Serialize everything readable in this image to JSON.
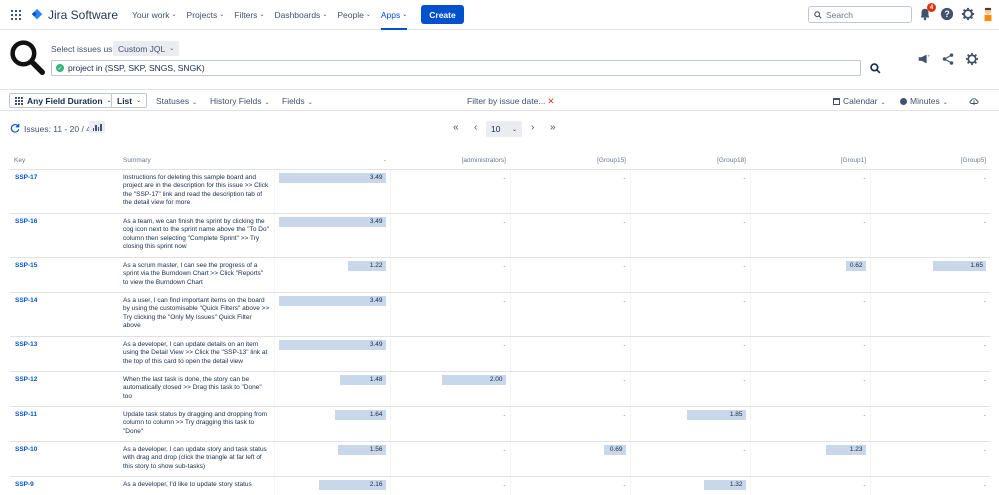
{
  "nav": {
    "logo_text": "Jira Software",
    "items": [
      {
        "label": "Your work",
        "active": false
      },
      {
        "label": "Projects",
        "active": false
      },
      {
        "label": "Filters",
        "active": false
      },
      {
        "label": "Dashboards",
        "active": false
      },
      {
        "label": "People",
        "active": false
      },
      {
        "label": "Apps",
        "active": true
      }
    ],
    "create_label": "Create",
    "search_placeholder": "Search",
    "notification_count": "4",
    "chevron": "⌄"
  },
  "jql": {
    "select_label": "Select issues using",
    "mode": "Custom JQL",
    "query": "project in (SSP, SKP, SNGS, SNGK)"
  },
  "toolbar": {
    "any_field_duration": "Any Field Duration",
    "list": "List",
    "statuses": "Statuses",
    "history_fields": "History Fields",
    "fields": "Fields",
    "filter_by_date": "Filter by issue date...",
    "calendar": "Calendar",
    "minutes": "Minutes"
  },
  "issues": {
    "count": "Issues: 11 - 20 / 47",
    "page_size": "10",
    "first": "«",
    "prev": "‹",
    "next": "›",
    "last": "»"
  },
  "table": {
    "headers": [
      "Key",
      "Summary",
      "-",
      "[administrators]",
      "[Group15]",
      "[Group18]",
      "[Group1]",
      "[Group5]"
    ],
    "max_value": 3.49,
    "rows": [
      {
        "key": "SSP-17",
        "summary": "Instructions for deleting this sample board and project are in the description for this issue >> Click the \"SSP-17\" link and read the description tab of the detail view for more",
        "values": [
          "3.49",
          "-",
          "-",
          "-",
          "-",
          "-"
        ]
      },
      {
        "key": "SSP-16",
        "summary": "As a team, we can finish the sprint by clicking the cog icon next to the sprint name above the \"To Do\" column then selecting \"Complete Sprint\" >> Try closing this sprint now",
        "values": [
          "3.49",
          "-",
          "-",
          "-",
          "-",
          "-"
        ]
      },
      {
        "key": "SSP-15",
        "summary": "As a scrum master, I can see the progress of a sprint via the Burndown Chart >> Click \"Reports\" to view the Burndown Chart",
        "values": [
          "1.22",
          "-",
          "-",
          "-",
          "0.62",
          "1.65"
        ]
      },
      {
        "key": "SSP-14",
        "summary": "As a user, I can find important items on the board by using the customisable \"Quick Filters\" above >> Try clicking the \"Only My Issues\" Quick Filter above",
        "values": [
          "3.49",
          "-",
          "-",
          "-",
          "-",
          "-"
        ]
      },
      {
        "key": "SSP-13",
        "summary": "As a developer, I can update details on an item using the Detail View >> Click the \"SSP-13\" link at the top of this card to open the detail view",
        "values": [
          "3.49",
          "-",
          "-",
          "-",
          "-",
          "-"
        ]
      },
      {
        "key": "SSP-12",
        "summary": "When the last task is done, the story can be automatically closed >> Drag this task to \"Done\" too",
        "values": [
          "1.48",
          "2.00",
          "-",
          "-",
          "-",
          "-"
        ]
      },
      {
        "key": "SSP-11",
        "summary": "Update task status by dragging and dropping from column to column >> Try dragging this task to \"Done\"",
        "values": [
          "1.64",
          "-",
          "-",
          "1.85",
          "-",
          "-"
        ]
      },
      {
        "key": "SSP-10",
        "summary": "As a developer, I can update story and task status with drag and drop (click the triangle at far left of this story to show sub-tasks)",
        "values": [
          "1.56",
          "-",
          "0.69",
          "-",
          "1.23",
          "-"
        ]
      },
      {
        "key": "SSP-9",
        "summary": "As a developer, I'd like to update story status",
        "values": [
          "2.16",
          "-",
          "-",
          "1.32",
          "-",
          "-"
        ]
      }
    ]
  }
}
